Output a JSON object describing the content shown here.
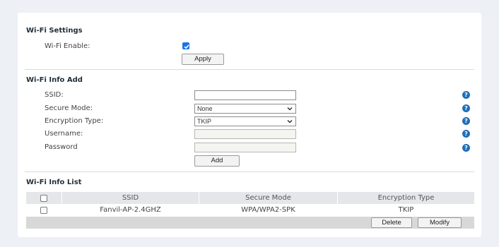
{
  "wifi_settings": {
    "title": "Wi-Fi Settings",
    "enable_label": "Wi-Fi Enable:",
    "enable_checked": true,
    "apply_label": "Apply"
  },
  "wifi_info_add": {
    "title": "Wi-Fi Info Add",
    "ssid_label": "SSID:",
    "ssid_value": "",
    "secure_mode_label": "Secure Mode:",
    "secure_mode_value": "None",
    "encryption_label": "Encryption Type:",
    "encryption_value": "TKIP",
    "username_label": "Username:",
    "username_value": "",
    "password_label": "Password",
    "password_value": "",
    "add_label": "Add",
    "help_glyph": "?"
  },
  "wifi_info_list": {
    "title": "Wi-Fi Info List",
    "columns": [
      "SSID",
      "Secure Mode",
      "Encryption Type"
    ],
    "rows": [
      {
        "ssid": "Fanvil-AP-2.4GHZ",
        "secure_mode": "WPA/WPA2-SPK",
        "encryption": "TKIP"
      }
    ],
    "delete_label": "Delete",
    "modify_label": "Modify"
  },
  "colors": {
    "accent": "#1a73e8",
    "help_icon": "#1f6fb8",
    "table_header": "#e4e6ea",
    "table_footer": "#d8d8d8",
    "page_bg": "#edf1f6"
  },
  "icons": [
    "checkbox-checked-icon",
    "help-icon",
    "chevron-down-icon"
  ]
}
